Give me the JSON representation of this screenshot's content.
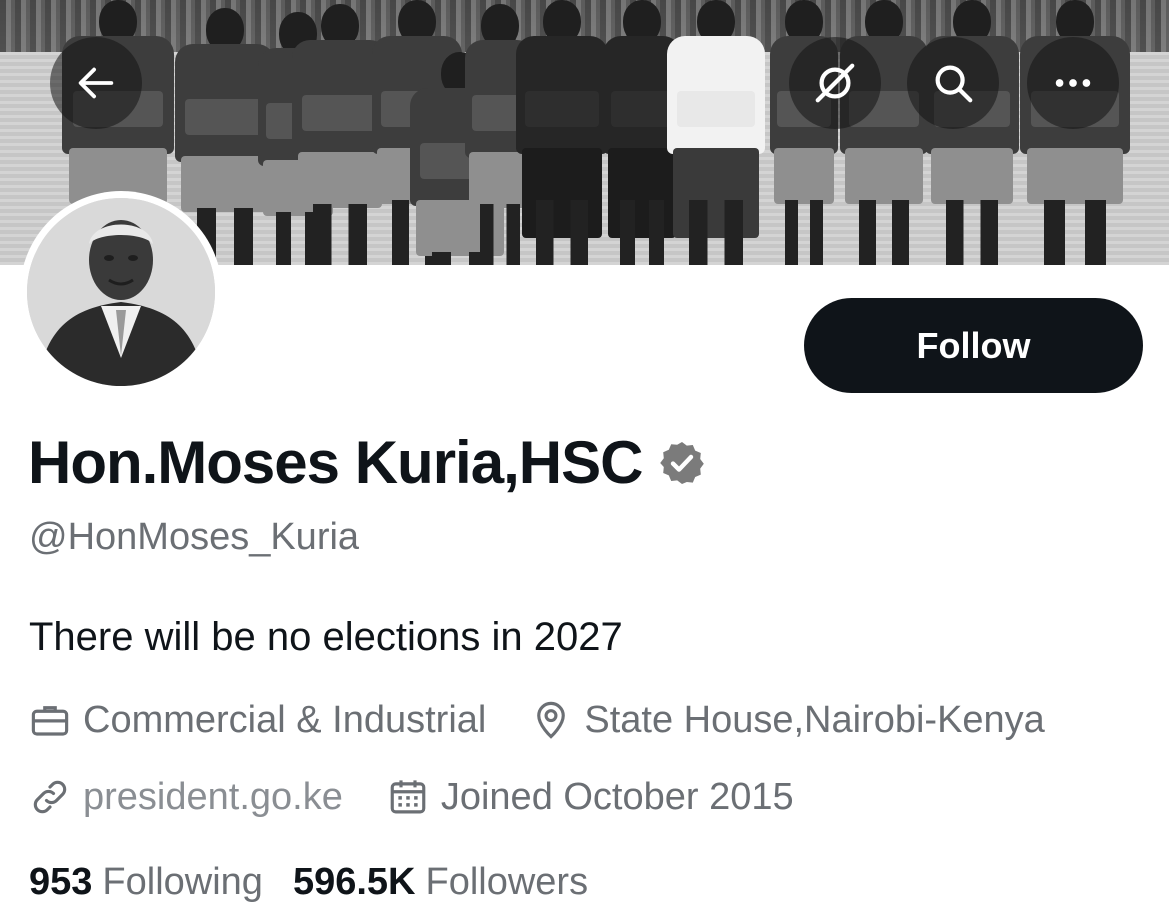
{
  "header": {
    "back_icon": "arrow-left-icon",
    "grok_icon": "grok-icon",
    "search_icon": "search-icon",
    "more_icon": "more-horizontal-icon"
  },
  "profile": {
    "display_name": "Hon.Moses Kuria,HSC",
    "handle": "@HonMoses_Kuria",
    "verified": true,
    "bio": "There will be no elections in 2027",
    "category": "Commercial & Industrial",
    "location": "State House,Nairobi-Kenya",
    "website": "president.go.ke",
    "joined": "Joined October 2015",
    "following_count": "953",
    "following_label": "Following",
    "followers_count": "596.5K",
    "followers_label": "Followers"
  },
  "actions": {
    "follow_label": "Follow"
  },
  "colors": {
    "text": "#0f1419",
    "secondary": "#6b6f74",
    "button_bg": "#0f1419",
    "button_text": "#ffffff"
  }
}
